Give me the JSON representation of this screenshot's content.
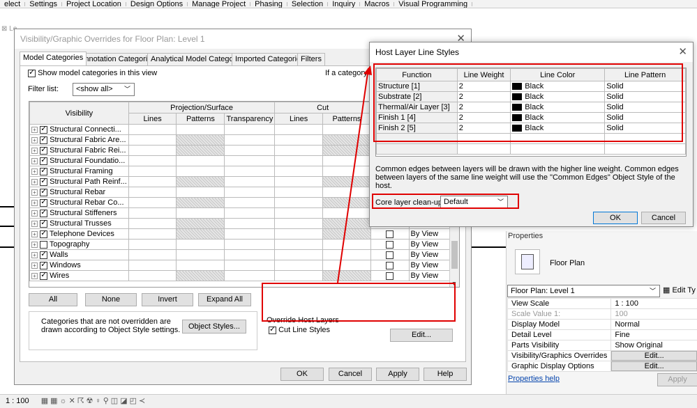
{
  "ribbon": [
    "elect",
    "Settings",
    "Project Location",
    "Design Options",
    "Manage Project",
    "Phasing",
    "Selection",
    "Inquiry",
    "Macros",
    "Visual Programming"
  ],
  "vg": {
    "title": "Visibility/Graphic Overrides for Floor Plan: Level 1",
    "tabs": [
      "Model Categories",
      "Annotation Categories",
      "Analytical Model Categories",
      "Imported Categories",
      "Filters"
    ],
    "show_label": "Show model categories in this view",
    "if_text": "If a category is",
    "filter_label": "Filter list:",
    "filter_value": "<show all>",
    "col_visibility": "Visibility",
    "col_projection": "Projection/Surface",
    "col_cut": "Cut",
    "sub_lines": "Lines",
    "sub_patterns": "Patterns",
    "sub_transparency": "Transparency",
    "by_view": "By View",
    "rows": [
      {
        "name": "Structural Connecti...",
        "checked": true,
        "hatch": false,
        "right": false
      },
      {
        "name": "Structural Fabric Are...",
        "checked": true,
        "hatch": true,
        "right": false
      },
      {
        "name": "Structural Fabric Rei...",
        "checked": true,
        "hatch": true,
        "right": false
      },
      {
        "name": "Structural Foundatio...",
        "checked": true,
        "hatch": false,
        "right": false
      },
      {
        "name": "Structural Framing",
        "checked": true,
        "hatch": false,
        "right": false
      },
      {
        "name": "Structural Path Reinf...",
        "checked": true,
        "hatch": true,
        "right": false
      },
      {
        "name": "Structural Rebar",
        "checked": true,
        "hatch": false,
        "right": false
      },
      {
        "name": "Structural Rebar Co...",
        "checked": true,
        "hatch": true,
        "right": false
      },
      {
        "name": "Structural Stiffeners",
        "checked": true,
        "hatch": false,
        "right": false
      },
      {
        "name": "Structural Trusses",
        "checked": true,
        "hatch": true,
        "right": false
      },
      {
        "name": "Telephone Devices",
        "checked": true,
        "hatch": true,
        "right": true
      },
      {
        "name": "Topography",
        "checked": false,
        "hatch": false,
        "right": true
      },
      {
        "name": "Walls",
        "checked": true,
        "hatch": false,
        "right": true
      },
      {
        "name": "Windows",
        "checked": true,
        "hatch": false,
        "right": true
      },
      {
        "name": "Wires",
        "checked": true,
        "hatch": true,
        "right": true
      }
    ],
    "btn_all": "All",
    "btn_none": "None",
    "btn_invert": "Invert",
    "btn_expand": "Expand All",
    "note": "Categories that are not overridden are drawn according to Object Style settings.",
    "btn_object_styles": "Object Styles...",
    "override_title": "Override Host Layers",
    "cut_line_styles": "Cut Line Styles",
    "btn_edit": "Edit...",
    "btn_ok": "OK",
    "btn_cancel": "Cancel",
    "btn_apply": "Apply",
    "btn_help": "Help"
  },
  "hl": {
    "title": "Host Layer Line Styles",
    "headers": [
      "Function",
      "Line Weight",
      "Line Color",
      "Line Pattern"
    ],
    "rows": [
      {
        "fn": "Structure [1]",
        "w": "2",
        "c": "Black",
        "p": "Solid"
      },
      {
        "fn": "Substrate [2]",
        "w": "2",
        "c": "Black",
        "p": "Solid"
      },
      {
        "fn": "Thermal/Air Layer [3]",
        "w": "2",
        "c": "Black",
        "p": "Solid"
      },
      {
        "fn": "Finish 1 [4]",
        "w": "2",
        "c": "Black",
        "p": "Solid"
      },
      {
        "fn": "Finish 2 [5]",
        "w": "2",
        "c": "Black",
        "p": "Solid"
      }
    ],
    "note": "Common edges between layers will be drawn with the higher line weight.  Common edges between layers of the same line weight will use the \"Common Edges\" Object Style of the host.",
    "cleanup_label": "Core layer clean-up",
    "cleanup_value": "Default",
    "btn_ok": "OK",
    "btn_cancel": "Cancel"
  },
  "props": {
    "title": "Properties",
    "type_name": "Floor Plan",
    "selector": "Floor Plan: Level 1",
    "edit_type": "Edit Ty",
    "rows": [
      {
        "k": "View Scale",
        "v": "1 : 100",
        "btn": false,
        "dim": false
      },
      {
        "k": "Scale Value    1:",
        "v": "100",
        "btn": false,
        "dim": true
      },
      {
        "k": "Display Model",
        "v": "Normal",
        "btn": false,
        "dim": false
      },
      {
        "k": "Detail Level",
        "v": "Fine",
        "btn": false,
        "dim": false
      },
      {
        "k": "Parts Visibility",
        "v": "Show Original",
        "btn": false,
        "dim": false
      },
      {
        "k": "Visibility/Graphics Overrides",
        "v": "Edit...",
        "btn": true,
        "dim": false
      },
      {
        "k": "Graphic Display Options",
        "v": "Edit...",
        "btn": true,
        "dim": false
      }
    ],
    "help": "Properties help",
    "apply": "Apply"
  },
  "status": {
    "scale": "1 : 100"
  },
  "bg_tab": "Le"
}
